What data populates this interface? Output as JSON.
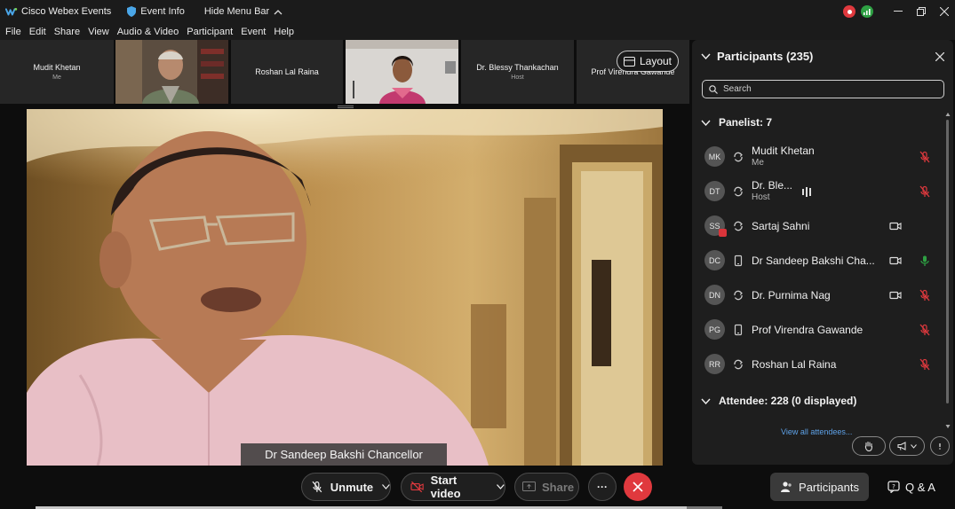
{
  "titlebar": {
    "app_title": "Cisco Webex Events",
    "event_info": "Event Info",
    "hide_menu": "Hide Menu Bar"
  },
  "menu": {
    "items": [
      "File",
      "Edit",
      "Share",
      "View",
      "Audio & Video",
      "Participant",
      "Event",
      "Help"
    ]
  },
  "strip": {
    "thumbs": [
      {
        "name": "Mudit Khetan",
        "role": "Me"
      },
      {
        "name": "",
        "role": ""
      },
      {
        "name": "Roshan Lal Raina",
        "role": ""
      },
      {
        "name": "",
        "role": ""
      },
      {
        "name": "Dr. Blessy Thankachan",
        "role": "Host"
      },
      {
        "name": "Prof Virendra Gawande",
        "role": ""
      }
    ],
    "layout_label": "Layout"
  },
  "stage": {
    "speaker_name": "Dr Sandeep Bakshi Chancellor"
  },
  "panel": {
    "title": "Participants (235)",
    "search_placeholder": "Search",
    "panelist_header": "Panelist: 7",
    "attendee_header": "Attendee: 228 (0 displayed)",
    "view_all": "View all attendees...",
    "panelists": [
      {
        "initials": "MK",
        "name": "Mudit Khetan",
        "role": "Me",
        "device": "sync",
        "video": false,
        "mic": "muted"
      },
      {
        "initials": "DT",
        "name": "Dr. Ble...",
        "role": "Host",
        "device": "sync",
        "video": false,
        "mic": "muted",
        "speaking": true
      },
      {
        "initials": "SS",
        "name": "Sartaj Sahni",
        "role": "",
        "device": "sync",
        "video": true,
        "mic": "none",
        "badge": true
      },
      {
        "initials": "DC",
        "name": "Dr Sandeep Bakshi Cha...",
        "role": "",
        "device": "phone",
        "video": true,
        "mic": "active"
      },
      {
        "initials": "DN",
        "name": "Dr. Purnima Nag",
        "role": "",
        "device": "sync",
        "video": true,
        "mic": "muted"
      },
      {
        "initials": "PG",
        "name": "Prof Virendra Gawande",
        "role": "",
        "device": "phone",
        "video": false,
        "mic": "muted"
      },
      {
        "initials": "RR",
        "name": "Roshan Lal Raina",
        "role": "",
        "device": "sync",
        "video": false,
        "mic": "muted"
      }
    ]
  },
  "controls": {
    "unmute": "Unmute",
    "start_video": "Start video",
    "share": "Share",
    "more": "···",
    "participants": "Participants",
    "qa": "Q & A"
  },
  "colors": {
    "end_call": "#e0393e",
    "mic_muted": "#e0393e",
    "mic_active": "#2ea043",
    "link": "#5ea2e8"
  }
}
